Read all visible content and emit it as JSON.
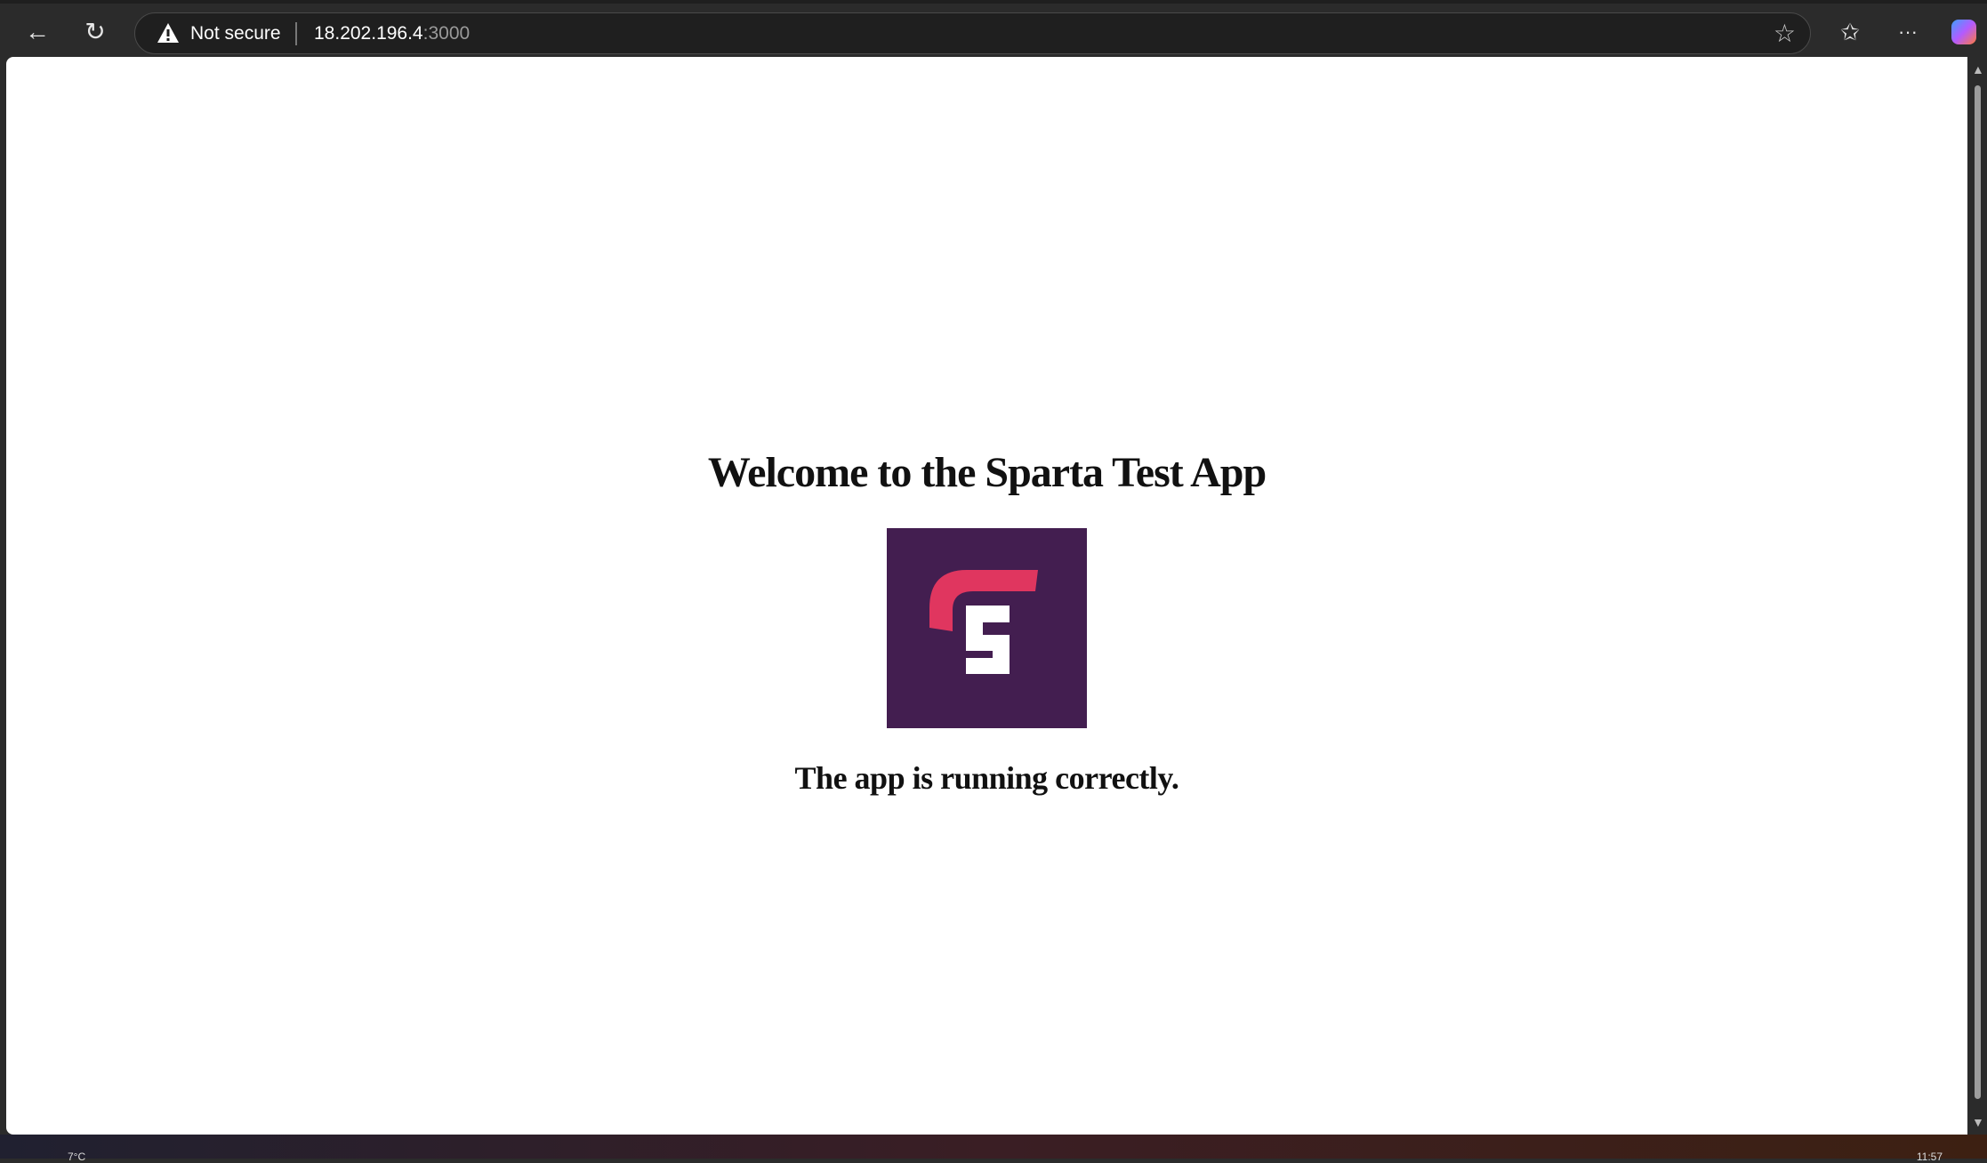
{
  "browser": {
    "security_label": "Not secure",
    "url_host": "18.202.196.4",
    "url_port": ":3000"
  },
  "page": {
    "heading": "Welcome to the Sparta Test App",
    "logo_alt": "Sparta logo S",
    "message": "The app is running correctly."
  },
  "taskbar": {
    "weather": "7°C",
    "clock": "11:57"
  },
  "colors": {
    "logo_bg": "#431e50",
    "logo_accent": "#e0365f"
  }
}
